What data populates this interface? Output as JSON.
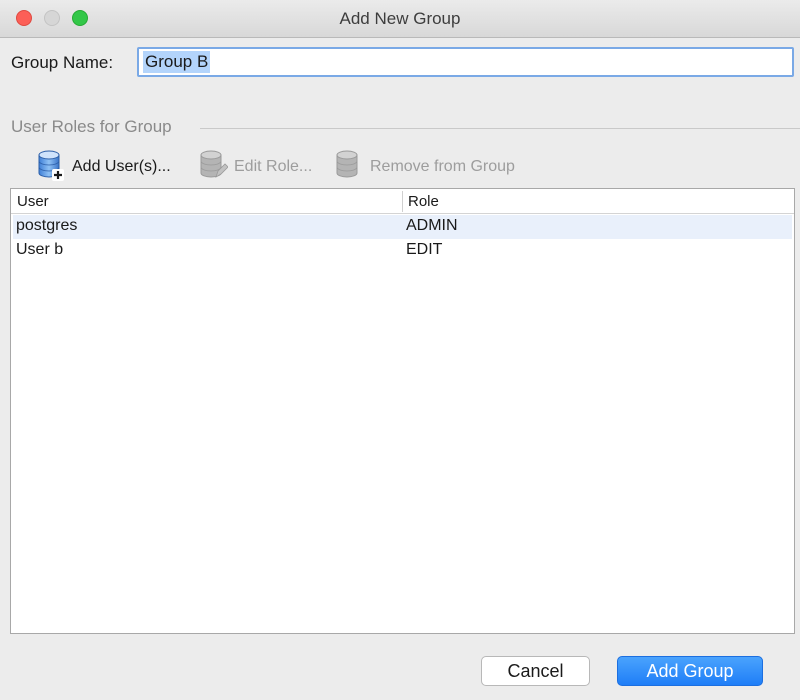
{
  "window": {
    "title": "Add New Group"
  },
  "form": {
    "group_name_label": "Group Name:",
    "group_name_value": "Group B"
  },
  "section": {
    "title": "User Roles for Group"
  },
  "toolbar": {
    "add_users_label": "Add User(s)...",
    "add_users_icon": "database-add-icon",
    "edit_role_label": "Edit Role...",
    "edit_role_icon": "database-edit-icon",
    "remove_label": "Remove from Group",
    "remove_icon": "database-remove-icon"
  },
  "table": {
    "columns": [
      "User",
      "Role"
    ],
    "rows": [
      {
        "user": "postgres",
        "role": "ADMIN"
      },
      {
        "user": "User b",
        "role": "EDIT"
      }
    ]
  },
  "footer": {
    "cancel_label": "Cancel",
    "submit_label": "Add Group"
  },
  "colors": {
    "accent": "#1f7ef7",
    "selection": "#b3d4fb",
    "row_highlight": "#e9f0fb"
  }
}
